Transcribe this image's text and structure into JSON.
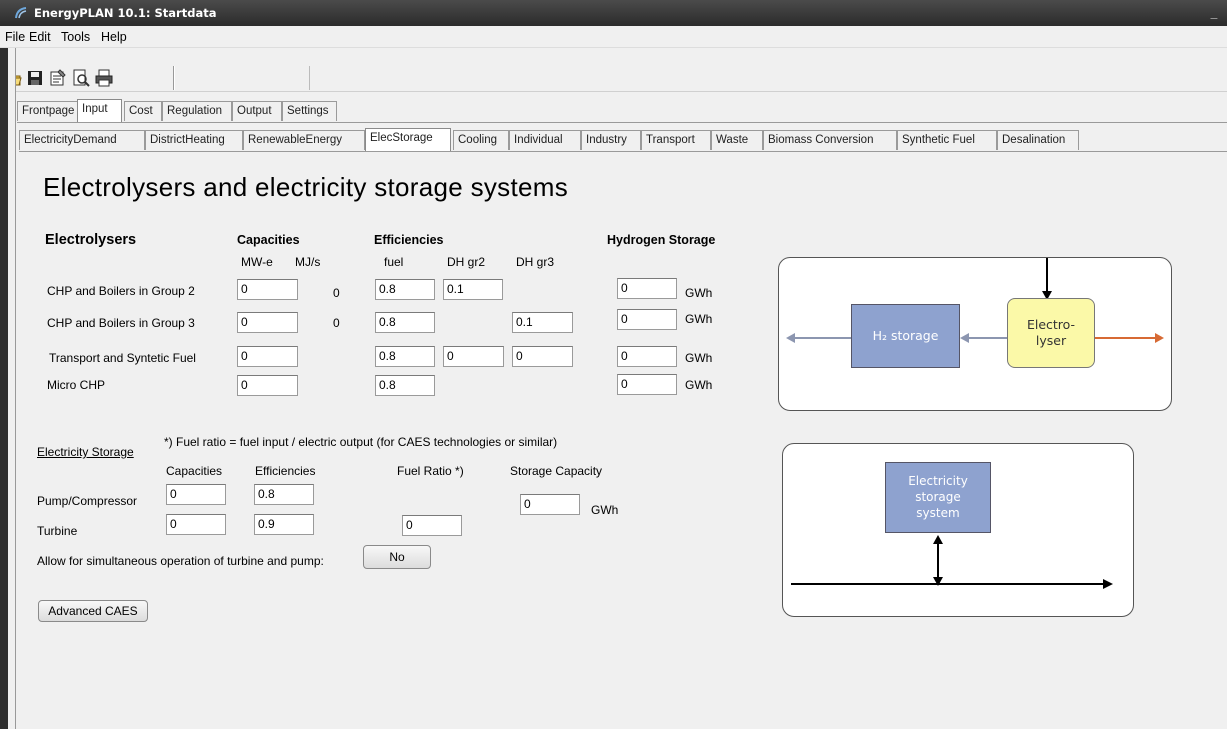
{
  "window": {
    "title": "EnergyPLAN 10.1: Startdata",
    "minimize_label": "_"
  },
  "menu": [
    "File",
    "Edit",
    "Tools",
    "Help"
  ],
  "toolbar": {
    "icons": [
      "open-folder-icon",
      "save-icon",
      "properties-icon",
      "print-preview-icon",
      "print-icon"
    ]
  },
  "main_tabs": [
    "Frontpage",
    "Input",
    "Cost",
    "Regulation",
    "Output",
    "Settings"
  ],
  "main_tab_active": "Input",
  "sub_tabs": [
    "ElectricityDemand",
    "DistrictHeating",
    "RenewableEnergy",
    "ElecStorage",
    "Cooling",
    "Individual",
    "Industry",
    "Transport",
    "Waste",
    "Biomass Conversion",
    "Synthetic Fuel",
    "Desalination"
  ],
  "sub_tab_active": "ElecStorage",
  "page": {
    "heading": "Electrolysers and electricity storage systems"
  },
  "electrolysers": {
    "title": "Electrolysers",
    "capacities_header": "Capacities",
    "efficiencies_header": "Efficiencies",
    "hydrogen_header": "Hydrogen Storage",
    "units": {
      "mwe": "MW-e",
      "mjs": "MJ/s",
      "fuel": "fuel",
      "dhgr2": "DH gr2",
      "dhgr3": "DH gr3"
    },
    "rows": [
      {
        "label": "CHP and Boilers in Group 2",
        "mwe": "0",
        "mjs": "0",
        "fuel": "0.8",
        "dhgr2": "0.1",
        "h2": "0",
        "unit": "GWh"
      },
      {
        "label": "CHP and Boilers in Group 3",
        "mwe": "0",
        "mjs": "0",
        "fuel": "0.8",
        "dhgr3": "0.1",
        "h2": "0",
        "unit": "GWh"
      },
      {
        "label": "Transport and Syntetic Fuel",
        "mwe": "0",
        "fuel": "0.8",
        "dhgr2": "0",
        "dhgr3": "0",
        "h2": "0",
        "unit": "GWh"
      },
      {
        "label": "Micro CHP",
        "mwe": "0",
        "fuel": "0.8",
        "h2": "0",
        "unit": "GWh"
      }
    ]
  },
  "storage": {
    "title": "Electricity Storage",
    "note": "*) Fuel ratio = fuel input / electric output (for CAES technologies or similar)",
    "capacities_header": "Capacities",
    "efficiencies_header": "Efficiencies",
    "fuel_ratio_header": "Fuel Ratio *)",
    "storage_capacity_header": "Storage Capacity",
    "pump": {
      "label": "Pump/Compressor",
      "capacity": "0",
      "efficiency": "0.8"
    },
    "turbine": {
      "label": "Turbine",
      "capacity": "0",
      "efficiency": "0.9",
      "fuel_ratio": "0"
    },
    "storage_capacity": "0",
    "storage_unit": "GWh",
    "simultaneous_label": "Allow for simultaneous operation of turbine and pump:",
    "simultaneous_value": "No",
    "advanced_label": "Advanced CAES"
  },
  "diagram1": {
    "h2_storage": "H₂ storage",
    "electrolyser_line1": "Electro-",
    "electrolyser_line2": "lyser"
  },
  "diagram2": {
    "line1": "Electricity",
    "line2": "storage",
    "line3": "system"
  },
  "colors": {
    "storage_box": "#8ea2cf",
    "electrolyser_box": "#fbf9a8",
    "arrow_grey": "#8c96b0",
    "arrow_orange": "#d76a34"
  }
}
